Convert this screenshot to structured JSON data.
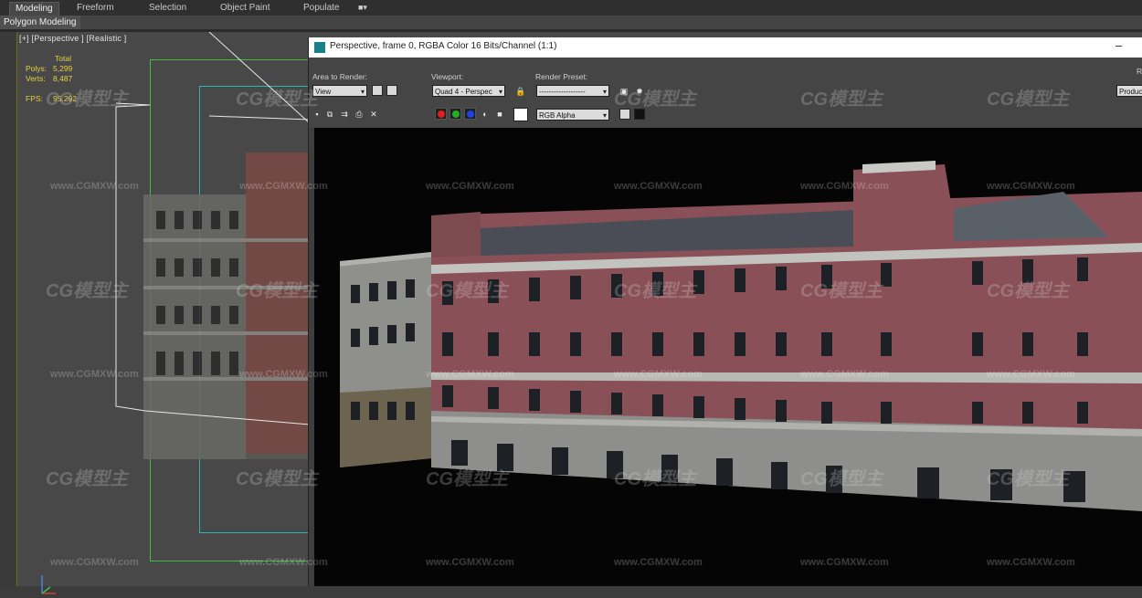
{
  "ribbon": {
    "tabs": [
      "Modeling",
      "Freeform",
      "Selection",
      "Object Paint",
      "Populate"
    ],
    "active_tab": "Modeling",
    "sub_label": "Polygon Modeling",
    "menu_icon": "dropdown-menu-icon"
  },
  "viewport": {
    "label": "[+] [Perspective ] [Realistic ]",
    "stats": {
      "header": "Total",
      "polys_label": "Polys:",
      "polys_value": "5,299",
      "verts_label": "Verts:",
      "verts_value": "8,487",
      "fps_label": "FPS:",
      "fps_value": "95.292"
    }
  },
  "render_window": {
    "title": "Perspective, frame 0, RGBA Color 16 Bits/Channel (1:1)",
    "area_to_render_label": "Area to Render:",
    "area_to_render_value": "View",
    "viewport_label": "Viewport:",
    "viewport_value": "Quad 4 - Perspec",
    "render_preset_label": "Render Preset:",
    "render_preset_value": "-------------------",
    "channel_value": "RGB Alpha",
    "production_value": "Producti",
    "render_button": "R"
  },
  "watermarks": {
    "text": "www.CGMXW.com",
    "logo": "CG模型主"
  },
  "colors": {
    "frame_green": "#3fbf3f",
    "frame_cyan": "#2fb3b3",
    "stats_yellow": "#e6d240",
    "app_accent": "#1a7f86"
  }
}
